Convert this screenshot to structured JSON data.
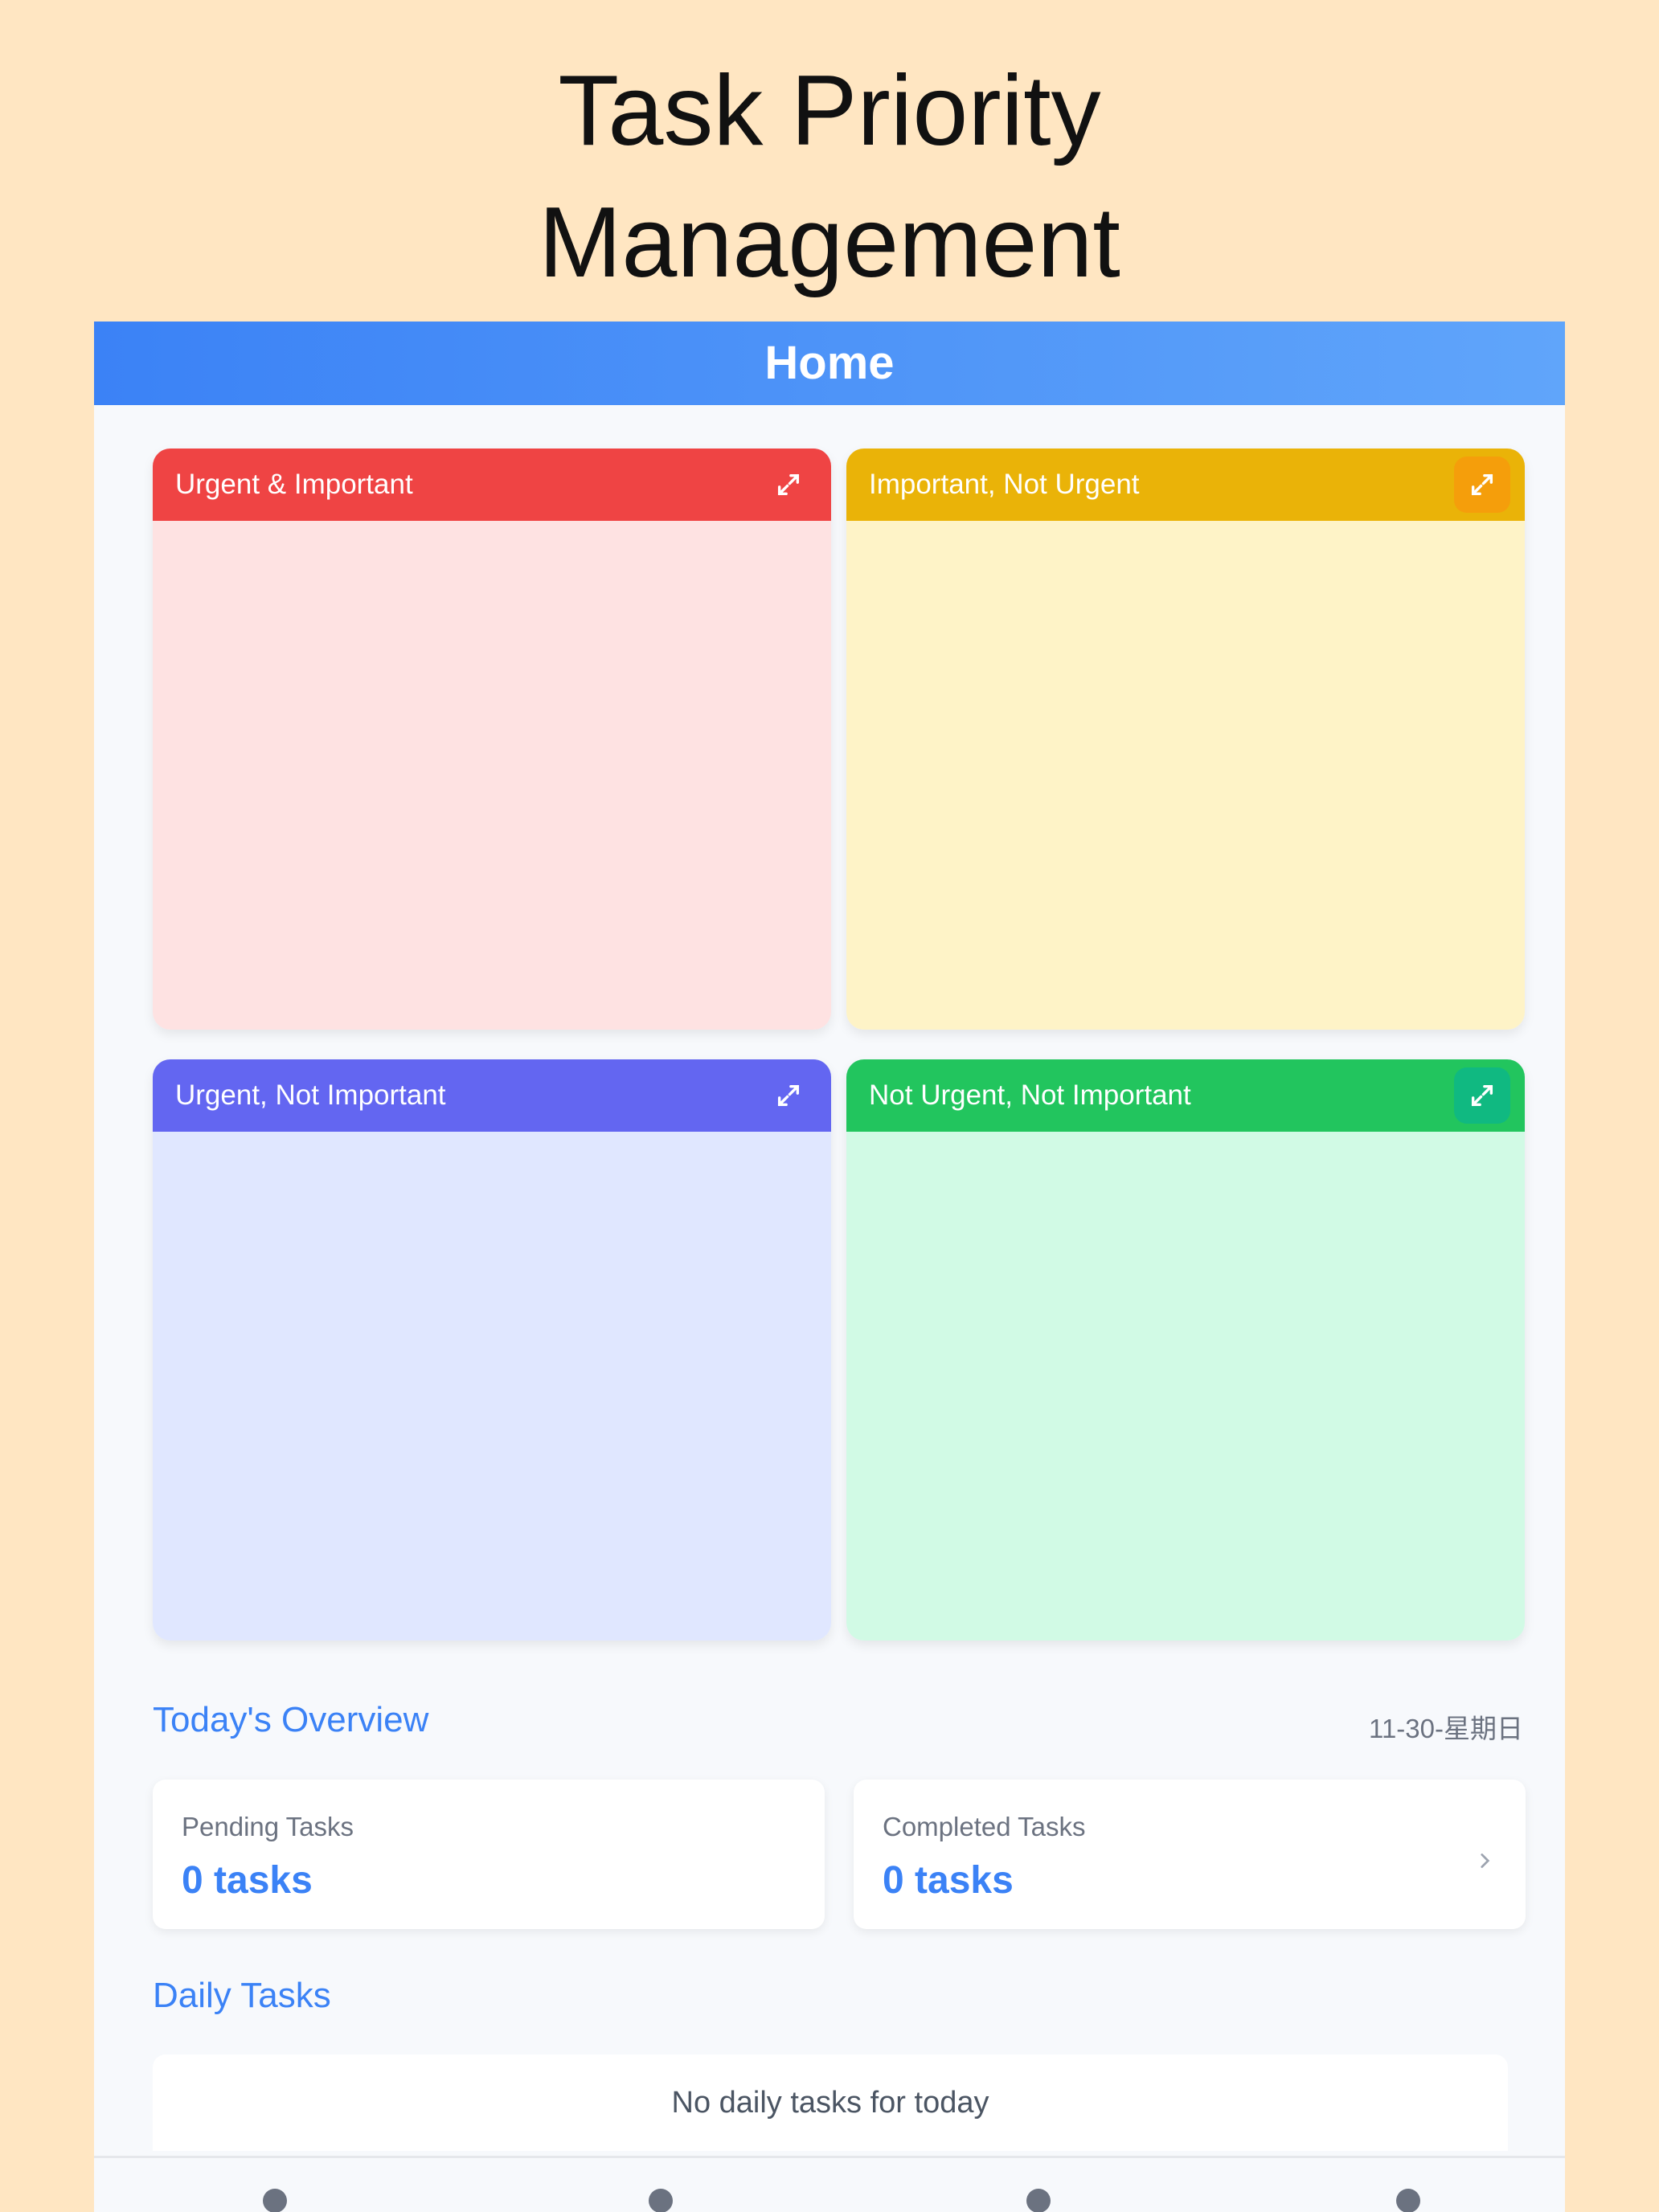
{
  "page": {
    "title_line1": "Task Priority",
    "title_line2": "Management"
  },
  "appbar": {
    "title": "Home"
  },
  "quadrants": [
    {
      "label": "Urgent & Important",
      "color": "#EF4444",
      "bg": "#FEE2E2"
    },
    {
      "label": "Important, Not Urgent",
      "color": "#EAB308",
      "bg": "#FEF3C7"
    },
    {
      "label": "Urgent, Not Important",
      "color": "#6366F1",
      "bg": "#E0E7FF"
    },
    {
      "label": "Not Urgent, Not Important",
      "color": "#22C55E",
      "bg": "#D1FAE5"
    }
  ],
  "overview": {
    "title": "Today's Overview",
    "date": "11-30-星期日",
    "pending_label": "Pending Tasks",
    "pending_value": "0 tasks",
    "completed_label": "Completed Tasks",
    "completed_value": "0 tasks"
  },
  "daily": {
    "title": "Daily Tasks",
    "empty_text": "No daily tasks for today"
  },
  "bottom_nav": {
    "items": [
      "home-icon",
      "stats-icon",
      "add-icon",
      "more-icon"
    ],
    "active": "home-icon"
  }
}
